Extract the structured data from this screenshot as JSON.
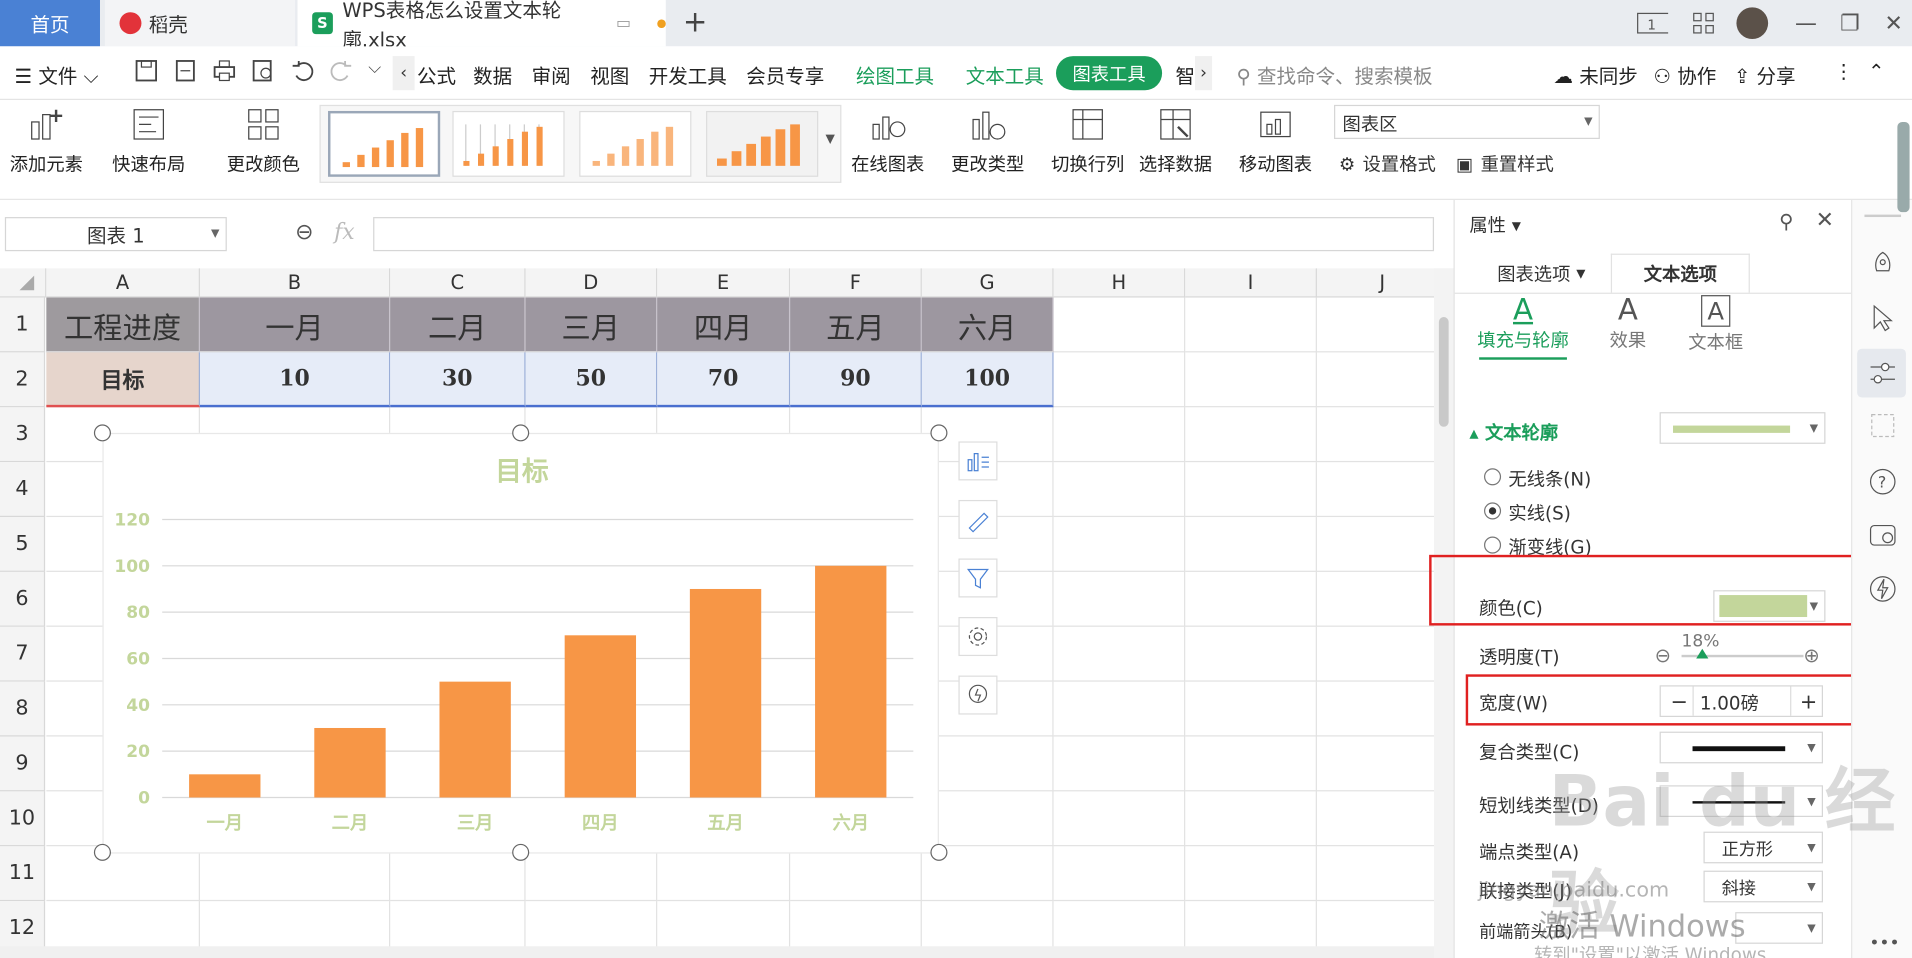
{
  "titlebar": {
    "tab_home": "首页",
    "tab_daoke": "稻壳",
    "tab_file": "WPS表格怎么设置文本轮廓.xlsx",
    "add_tab": "+"
  },
  "menubar": {
    "file": "文件",
    "items": [
      "公式",
      "数据",
      "审阅",
      "视图",
      "开发工具",
      "会员专享",
      "绘图工具",
      "文本工具"
    ],
    "active_tool": "图表工具",
    "more": "智",
    "search_placeholder": "查找命令、搜索模板",
    "sync": "未同步",
    "collab": "协作",
    "share": "分享"
  },
  "ribbon": {
    "add_element": "添加元素",
    "quick_layout": "快速布局",
    "change_color": "更改颜色",
    "online_chart": "在线图表",
    "change_type": "更改类型",
    "switch_rowcol": "切换行列",
    "select_data": "选择数据",
    "move_chart": "移动图表",
    "chart_area": "图表区",
    "set_format": "设置格式",
    "reset_style": "重置样式"
  },
  "formulabar": {
    "namebox": "图表 1",
    "fx": "fx"
  },
  "grid": {
    "columns": [
      "A",
      "B",
      "C",
      "D",
      "E",
      "F",
      "G",
      "H",
      "I",
      "J"
    ],
    "rows": [
      "1",
      "2",
      "3",
      "4",
      "5",
      "6",
      "7",
      "8",
      "9",
      "10",
      "11",
      "12"
    ],
    "row1": [
      "工程进度",
      "一月",
      "二月",
      "三月",
      "四月",
      "五月",
      "六月"
    ],
    "row2": [
      "目标",
      "10",
      "30",
      "50",
      "70",
      "90",
      "100"
    ]
  },
  "chart_data": {
    "type": "bar",
    "title": "目标",
    "categories": [
      "一月",
      "二月",
      "三月",
      "四月",
      "五月",
      "六月"
    ],
    "values": [
      10,
      30,
      50,
      70,
      90,
      100
    ],
    "yticks": [
      "0",
      "20",
      "40",
      "60",
      "80",
      "100",
      "120"
    ],
    "ylim": [
      0,
      120
    ],
    "grid": true,
    "bar_color": "#f79646",
    "text_color": "#c3d69b",
    "xlabel": "",
    "ylabel": ""
  },
  "panel": {
    "title": "属性",
    "tab_chart": "图表选项",
    "tab_text": "文本选项",
    "sub_fill": "填充与轮廓",
    "sub_effect": "效果",
    "sub_textbox": "文本框",
    "section": "文本轮廓",
    "outline_color": "#c3d69b",
    "no_line": "无线条(N)",
    "solid": "实线(S)",
    "gradient": "渐变线(G)",
    "color_label": "颜色(C)",
    "transparency_label": "透明度(T)",
    "transparency_value": "18%",
    "width_label": "宽度(W)",
    "width_value": "1.00磅",
    "compound_label": "复合类型(C)",
    "dash_label": "短划线类型(D)",
    "cap_label": "端点类型(A)",
    "cap_value": "正方形",
    "join_label": "联接类型(J)",
    "join_value": "斜接",
    "arrow_label": "前端箭头(B)"
  },
  "watermark": {
    "activate": "激活 Windows",
    "activate_sub": "转到\"设置\"以激活 Windows",
    "site": "jingyan.baidu.com",
    "brand": "Bai du 经验"
  }
}
